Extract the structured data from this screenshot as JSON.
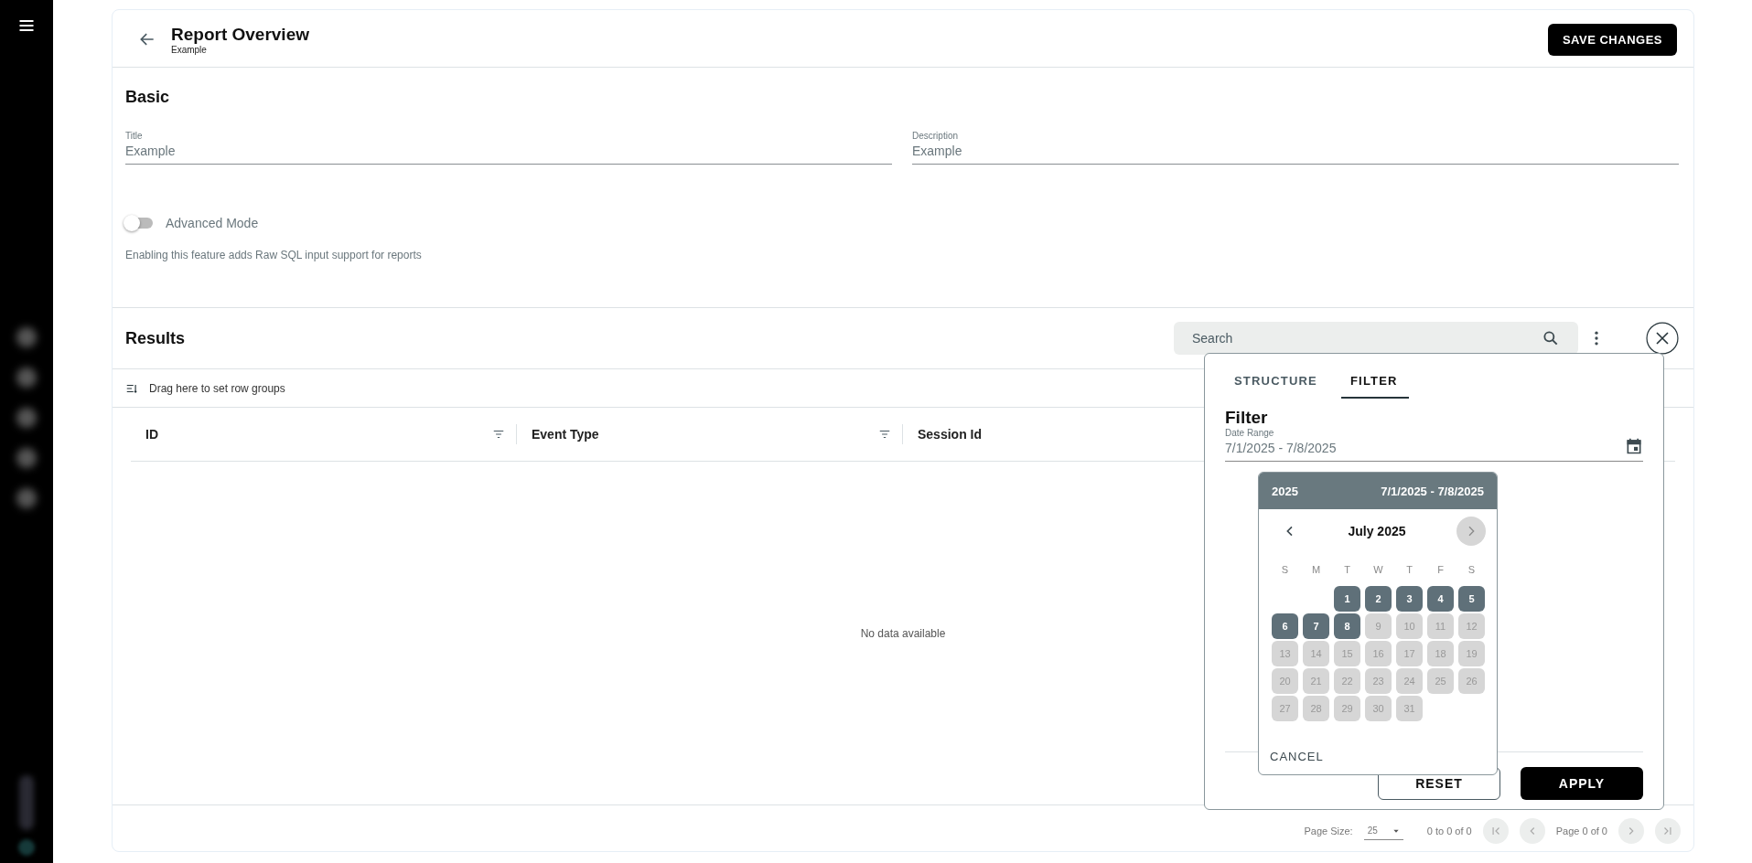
{
  "header": {
    "title": "Report Overview",
    "subtitle": "Example",
    "save_button": "SAVE CHANGES"
  },
  "basic": {
    "heading": "Basic",
    "fields": [
      {
        "label": "Title",
        "value": "Example"
      },
      {
        "label": "Description",
        "value": "Example"
      }
    ],
    "advanced_mode": {
      "label": "Advanced Mode",
      "on": false,
      "help": "Enabling this feature adds Raw SQL input support for reports"
    }
  },
  "results": {
    "heading": "Results",
    "search": {
      "placeholder": "Search"
    },
    "row_groups_hint": "Drag here to set row groups",
    "columns": [
      {
        "label": "ID",
        "filter": true
      },
      {
        "label": "Event Type",
        "filter": true
      },
      {
        "label": "Session Id",
        "filter": false
      }
    ],
    "empty_message": "No data available",
    "pagination": {
      "page_size_label": "Page Size:",
      "page_size": "25",
      "range": "0 to 0 of 0",
      "page": "Page 0 of 0"
    }
  },
  "panel": {
    "tabs": [
      {
        "label": "STRUCTURE",
        "selected": false
      },
      {
        "label": "FILTER",
        "selected": true
      }
    ],
    "heading": "Filter",
    "date_range": {
      "label": "Date Range",
      "value": "7/1/2025 - 7/8/2025"
    },
    "buttons": [
      {
        "label": "RESET",
        "kind": "outline"
      },
      {
        "label": "APPLY",
        "kind": "primary"
      }
    ]
  },
  "calendar": {
    "year": "2025",
    "range": "7/1/2025 - 7/8/2025",
    "month": "July 2025",
    "weekdays": [
      "S",
      "M",
      "T",
      "W",
      "T",
      "F",
      "S"
    ],
    "days": [
      {
        "kind": "blank"
      },
      {
        "kind": "blank"
      },
      {
        "kind": "day",
        "label": "1",
        "selected": true
      },
      {
        "kind": "day",
        "label": "2",
        "selected": true
      },
      {
        "kind": "day",
        "label": "3",
        "selected": true
      },
      {
        "kind": "day",
        "label": "4",
        "selected": true
      },
      {
        "kind": "day",
        "label": "5",
        "selected": true
      },
      {
        "kind": "day",
        "label": "6",
        "selected": true
      },
      {
        "kind": "day",
        "label": "7",
        "selected": true
      },
      {
        "kind": "day",
        "label": "8",
        "selected": true
      },
      {
        "kind": "day",
        "label": "9",
        "selected": false
      },
      {
        "kind": "day",
        "label": "10",
        "selected": false
      },
      {
        "kind": "day",
        "label": "11",
        "selected": false
      },
      {
        "kind": "day",
        "label": "12",
        "selected": false
      },
      {
        "kind": "day",
        "label": "13",
        "selected": false
      },
      {
        "kind": "day",
        "label": "14",
        "selected": false
      },
      {
        "kind": "day",
        "label": "15",
        "selected": false
      },
      {
        "kind": "day",
        "label": "16",
        "selected": false
      },
      {
        "kind": "day",
        "label": "17",
        "selected": false
      },
      {
        "kind": "day",
        "label": "18",
        "selected": false
      },
      {
        "kind": "day",
        "label": "19",
        "selected": false
      },
      {
        "kind": "day",
        "label": "20",
        "selected": false
      },
      {
        "kind": "day",
        "label": "21",
        "selected": false
      },
      {
        "kind": "day",
        "label": "22",
        "selected": false
      },
      {
        "kind": "day",
        "label": "23",
        "selected": false
      },
      {
        "kind": "day",
        "label": "24",
        "selected": false
      },
      {
        "kind": "day",
        "label": "25",
        "selected": false
      },
      {
        "kind": "day",
        "label": "26",
        "selected": false
      },
      {
        "kind": "day",
        "label": "27",
        "selected": false
      },
      {
        "kind": "day",
        "label": "28",
        "selected": false
      },
      {
        "kind": "day",
        "label": "29",
        "selected": false
      },
      {
        "kind": "day",
        "label": "30",
        "selected": false
      },
      {
        "kind": "day",
        "label": "31",
        "selected": false
      }
    ],
    "cancel": "CANCEL"
  }
}
